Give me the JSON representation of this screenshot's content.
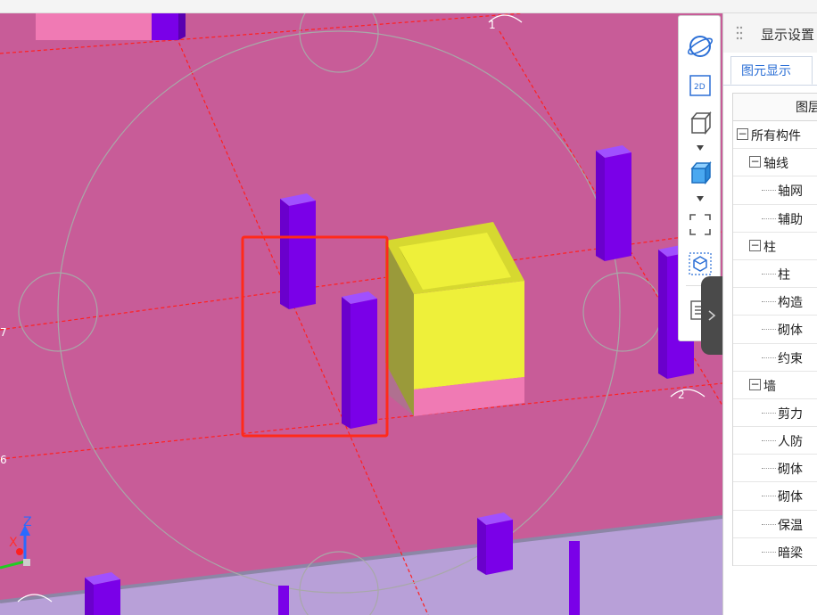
{
  "panel": {
    "title": "显示设置",
    "tab_active": "图元显示",
    "tree_header": "图层"
  },
  "tree": [
    {
      "label": "所有构件",
      "level": 0,
      "toggle": "−"
    },
    {
      "label": "轴线",
      "level": 1,
      "toggle": "−"
    },
    {
      "label": "轴网",
      "level": 2
    },
    {
      "label": "辅助",
      "level": 2
    },
    {
      "label": "柱",
      "level": 1,
      "toggle": "−"
    },
    {
      "label": "柱",
      "level": 2
    },
    {
      "label": "构造",
      "level": 2
    },
    {
      "label": "砌体",
      "level": 2
    },
    {
      "label": "约束",
      "level": 2
    },
    {
      "label": "墙",
      "level": 1,
      "toggle": "−"
    },
    {
      "label": "剪力",
      "level": 2
    },
    {
      "label": "人防",
      "level": 2
    },
    {
      "label": "砌体",
      "level": 2
    },
    {
      "label": "砌体",
      "level": 2
    },
    {
      "label": "保温",
      "level": 2
    },
    {
      "label": "暗梁",
      "level": 2
    }
  ],
  "toolbar": {
    "view_2d_label": "2D"
  },
  "viewport": {
    "axis_labels": {
      "x": "X",
      "z": "Z"
    },
    "axis_marks": [
      "7",
      "6",
      "1",
      "2"
    ],
    "colors": {
      "slab": "#c85c98",
      "column": "#7a00e8",
      "box": "#eef03a",
      "box_base": "#f07ab4",
      "selection": "#ff2a1a",
      "grid": "#ff2020",
      "ground": "#b8a0d8"
    }
  }
}
